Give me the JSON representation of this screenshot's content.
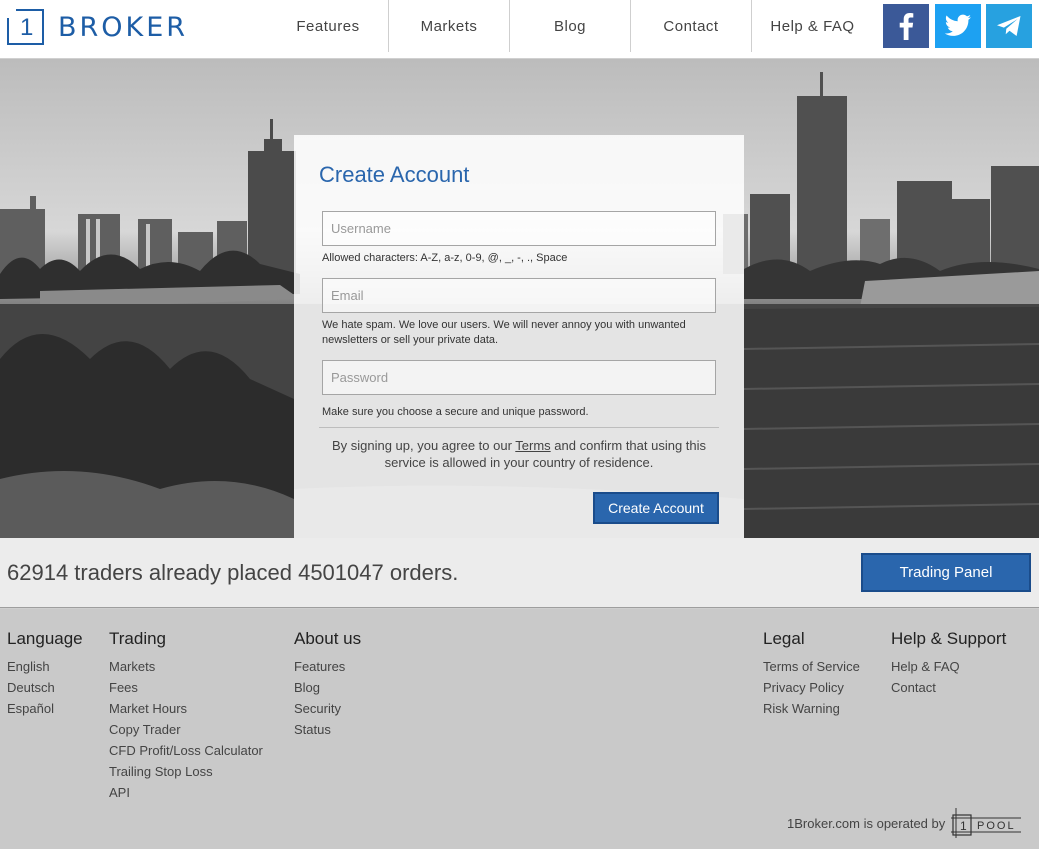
{
  "header": {
    "logo_number": "1",
    "logo_text": "BROKER",
    "nav": [
      "Features",
      "Markets",
      "Blog",
      "Contact",
      "Help & FAQ"
    ],
    "social": [
      "facebook-icon",
      "twitter-icon",
      "telegram-icon"
    ]
  },
  "form": {
    "title": "Create Account",
    "username_placeholder": "Username",
    "username_hint": "Allowed characters: A-Z, a-z, 0-9, @, _, -, ., Space",
    "email_placeholder": "Email",
    "email_hint": "We hate spam. We love our users. We will never annoy you with unwanted newsletters or sell your private data.",
    "password_placeholder": "Password",
    "password_hint": "Make sure you choose a secure and unique password.",
    "terms_before": "By signing up, you agree to our ",
    "terms_link": "Terms",
    "terms_after": " and confirm that using this service is allowed in your country of residence.",
    "submit": "Create Account"
  },
  "stats": {
    "text": "62914 traders already placed 4501047 orders.",
    "button": "Trading Panel"
  },
  "footer": {
    "language": {
      "title": "Language",
      "items": [
        "English",
        "Deutsch",
        "Español"
      ]
    },
    "trading": {
      "title": "Trading",
      "items": [
        "Markets",
        "Fees",
        "Market Hours",
        "Copy Trader",
        "CFD Profit/Loss Calculator",
        "Trailing Stop Loss",
        "API"
      ]
    },
    "about": {
      "title": "About us",
      "items": [
        "Features",
        "Blog",
        "Security",
        "Status"
      ]
    },
    "legal": {
      "title": "Legal",
      "items": [
        "Terms of Service",
        "Privacy Policy",
        "Risk Warning"
      ]
    },
    "help": {
      "title": "Help & Support",
      "items": [
        "Help & FAQ",
        "Contact"
      ]
    },
    "operated_by": "1Broker.com is operated by",
    "pool_logo_number": "1",
    "pool_logo_text": "POOL"
  },
  "colors": {
    "brand": "#2a66ad",
    "facebook": "#3b5998",
    "twitter": "#1da1f2",
    "telegram": "#27a1e0"
  }
}
